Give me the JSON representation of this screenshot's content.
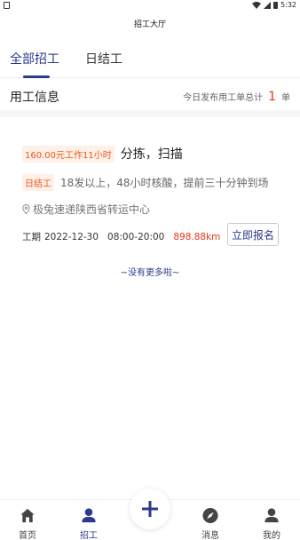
{
  "status_bar": {
    "time": "5:32"
  },
  "header": {
    "title": "招工大厅"
  },
  "tabs": [
    {
      "label": "全部招工",
      "active": true
    },
    {
      "label": "日结工",
      "active": false
    }
  ],
  "section": {
    "title": "用工信息",
    "count_prefix": "今日发布用工单总计",
    "count": "1",
    "count_unit": "单"
  },
  "job": {
    "salary_tag": "160.00元工作11小时",
    "title": "分拣，扫描",
    "daily_tag": "日结工",
    "description": "18发以上，48小时核酸，提前三十分钟到场",
    "location": "极兔速递陕西省转运中心",
    "period_label": "工期",
    "date": "2022-12-30",
    "time_range": "08:00-20:00",
    "distance": "898.88km",
    "apply_label": "立即报名"
  },
  "list_footer": "~没有更多啦~",
  "bottom_nav": {
    "items": [
      {
        "label": "首页",
        "icon": "home-icon"
      },
      {
        "label": "招工",
        "icon": "person-icon",
        "active": true
      },
      {
        "label": "消息",
        "icon": "compass-icon"
      },
      {
        "label": "我的",
        "icon": "user-icon"
      }
    ],
    "center_icon": "plus-icon"
  },
  "colors": {
    "accent": "#2b3a8c",
    "highlight": "#e8341c",
    "tag_bg": "#fff0e8"
  }
}
